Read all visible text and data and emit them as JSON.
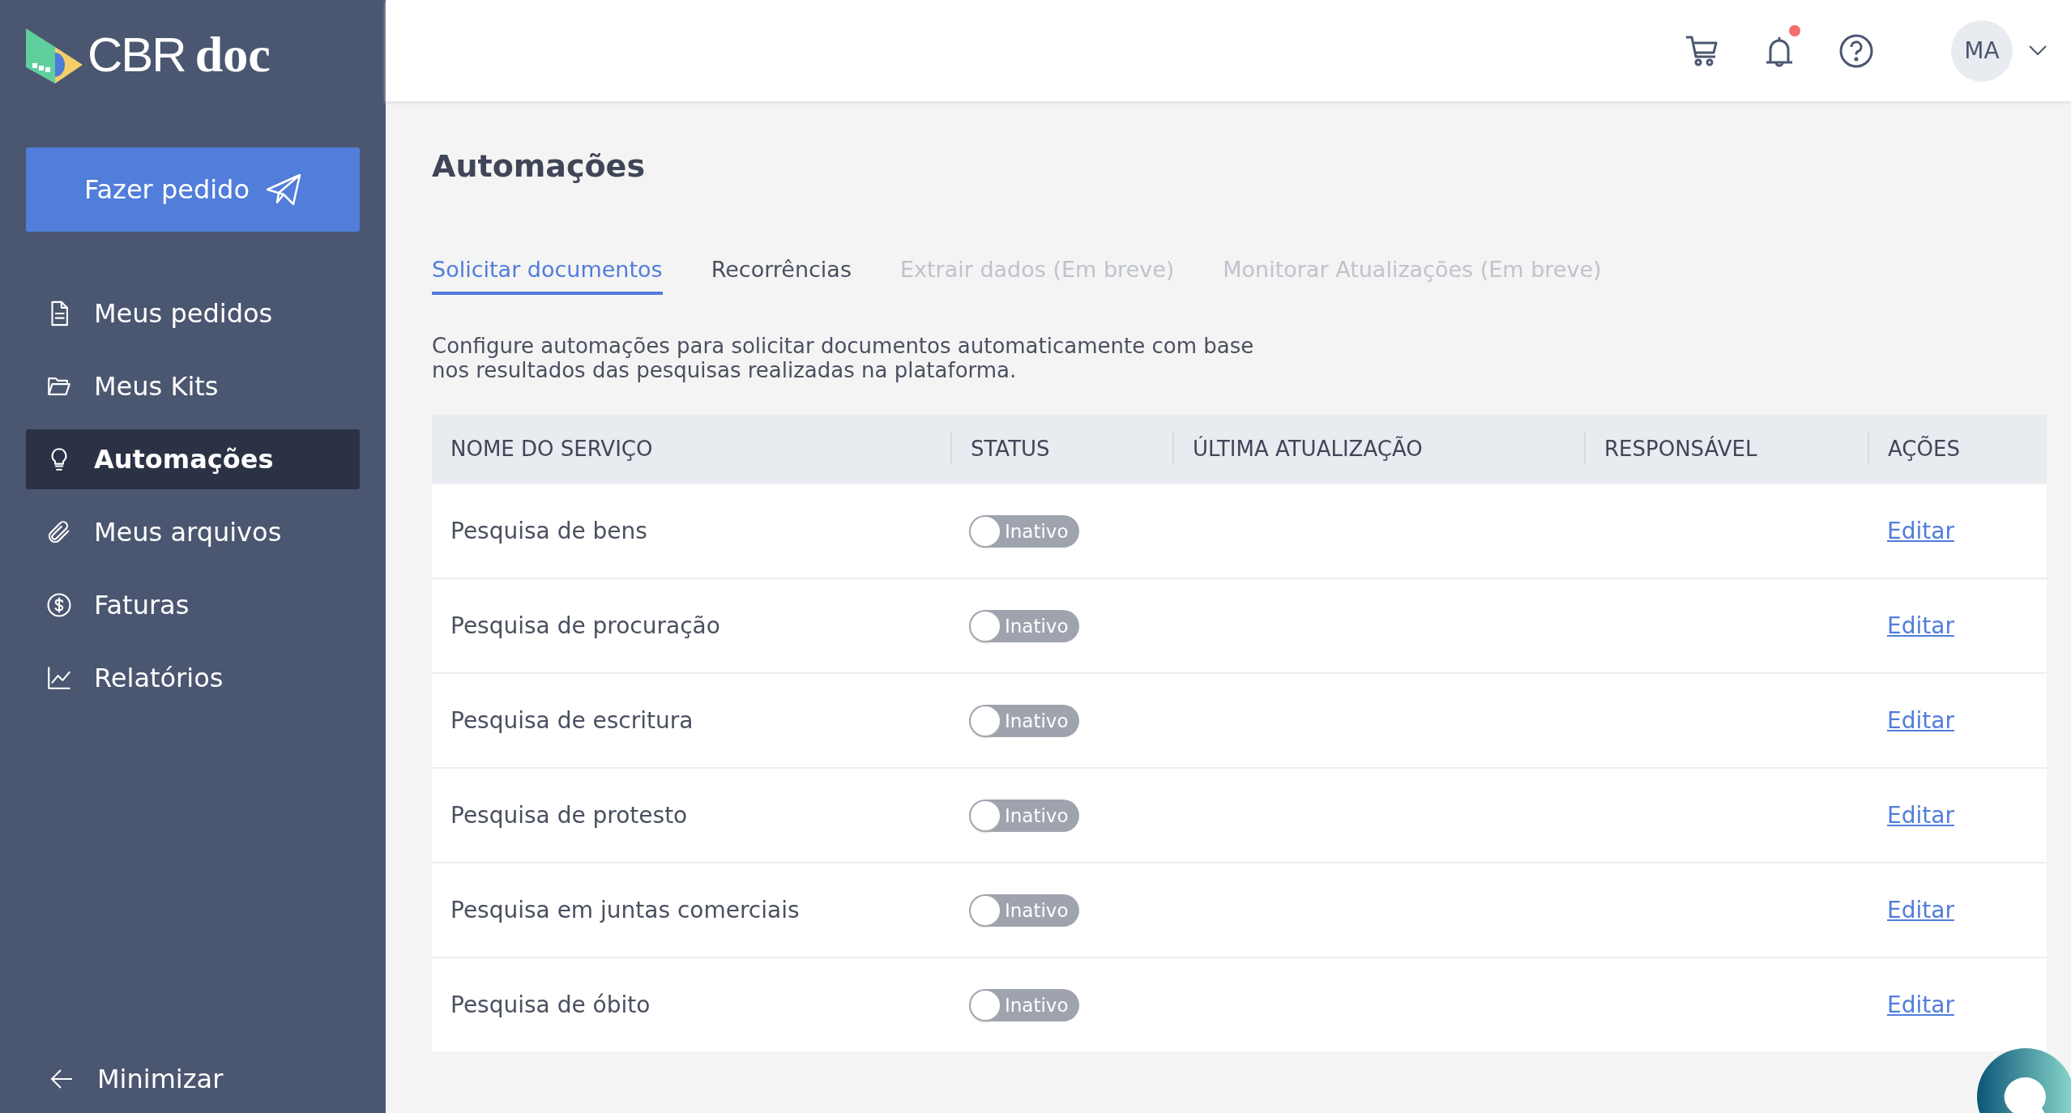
{
  "logo": {
    "brand": "CBR",
    "suffix": "doc"
  },
  "order_button": {
    "label": "Fazer pedido"
  },
  "sidebar": {
    "items": [
      {
        "label": "Meus pedidos",
        "selected": false
      },
      {
        "label": "Meus Kits",
        "selected": false
      },
      {
        "label": "Automações",
        "selected": true
      },
      {
        "label": "Meus arquivos",
        "selected": false
      },
      {
        "label": "Faturas",
        "selected": false
      },
      {
        "label": "Relatórios",
        "selected": false
      }
    ],
    "minimize": "Minimizar"
  },
  "header": {
    "notifications_unread": true,
    "avatar": "MA"
  },
  "page_title": "Automações",
  "tabs": [
    {
      "label": "Solicitar documentos",
      "selected": true,
      "disabled": false
    },
    {
      "label": "Recorrências",
      "selected": false,
      "disabled": false
    },
    {
      "label": "Extrair dados (Em breve)",
      "selected": false,
      "disabled": true
    },
    {
      "label": "Monitorar Atualizações (Em breve)",
      "selected": false,
      "disabled": true
    }
  ],
  "description": [
    "Configure automações para solicitar documentos automaticamente com base",
    "nos resultados das pesquisas realizadas na plataforma."
  ],
  "table": {
    "columns": [
      "NOME DO SERVIÇO",
      "STATUS",
      "ÚLTIMA ATUALIZAÇÃO",
      "RESPONSÁVEL",
      "AÇÕES"
    ],
    "rows": [
      {
        "name": "Pesquisa de bens",
        "on": false,
        "status": "Inativo",
        "action": "Editar"
      },
      {
        "name": "Pesquisa de procuração",
        "on": false,
        "status": "Inativo",
        "action": "Editar"
      },
      {
        "name": "Pesquisa de escritura",
        "on": false,
        "status": "Inativo",
        "action": "Editar"
      },
      {
        "name": "Pesquisa de protesto",
        "on": false,
        "status": "Inativo",
        "action": "Editar"
      },
      {
        "name": "Pesquisa em juntas comerciais",
        "on": false,
        "status": "Inativo",
        "action": "Editar"
      },
      {
        "name": "Pesquisa de óbito",
        "on": false,
        "status": "Inativo",
        "action": "Editar"
      }
    ]
  }
}
